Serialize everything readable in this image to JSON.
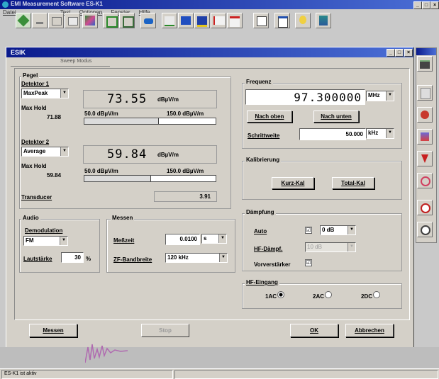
{
  "app": {
    "title": "EMI Measurement Software ES-K1"
  },
  "menu": [
    "Datei",
    "Test",
    "Optionen",
    "Fenster",
    "Hilfe"
  ],
  "window": {
    "title": "ESIK",
    "tab": "Sweep Modus"
  },
  "pegel": {
    "title": "Pegel",
    "d1": {
      "label": "Detektor 1",
      "detector": "MaxPeak",
      "maxhold_label": "Max Hold",
      "maxhold": "71.88",
      "value": "73.55",
      "unit": "dBµV/m",
      "bar_min": "50.0 dBµV/m",
      "bar_max": "150.0 dBµV/m",
      "bar_level": 0.56
    },
    "d2": {
      "label": "Detektor 2",
      "detector": "Average",
      "maxhold_label": "Max Hold",
      "maxhold": "59.84",
      "value": "59.84",
      "unit": "dBµV/m",
      "bar_min": "50.0 dBµV/m",
      "bar_max": "150.0 dBµV/m",
      "bar_level": 0.5
    },
    "transducer_label": "Transducer",
    "transducer_value": "3.91"
  },
  "frequenz": {
    "title": "Frequenz",
    "value": "97.300000",
    "unit": "MHz",
    "nach_oben": "Nach oben",
    "nach_unten": "Nach unten",
    "schrittweite_label": "Schrittweite",
    "schrittweite": "50.000",
    "schrittweite_unit": "kHz"
  },
  "kalibrierung": {
    "title": "Kalibrierung",
    "kurz": "Kurz-Kal",
    "total": "Total-Kal"
  },
  "audio": {
    "title": "Audio",
    "demod_label": "Demodulation",
    "demod": "FM",
    "laut_label": "Lautstärke",
    "laut": "30",
    "laut_unit": "%"
  },
  "messen": {
    "title": "Messen",
    "messzeit_label": "Meßzeit",
    "messzeit": "0.0100",
    "messzeit_unit": "s",
    "zf_label": "ZF-Bandbreite",
    "zf": "120 kHz"
  },
  "daempfung": {
    "title": "Dämpfung",
    "auto_label": "Auto",
    "auto_checked": "☑",
    "auto_value": "0 dB",
    "hf_label": "HF-Dämpf.",
    "hf_value": "10 dB",
    "vor_label": "Vorverstärker",
    "vor_checked": "☑"
  },
  "hf_eingang": {
    "title": "HF-Eingang",
    "opt1": "1AC",
    "opt2": "2AC",
    "opt3": "2DC"
  },
  "buttons": {
    "messen": "Messen",
    "stop": "Stop",
    "ok": "OK",
    "abbrechen": "Abbrechen"
  },
  "status": {
    "text": "ES-K1 ist aktiv"
  }
}
